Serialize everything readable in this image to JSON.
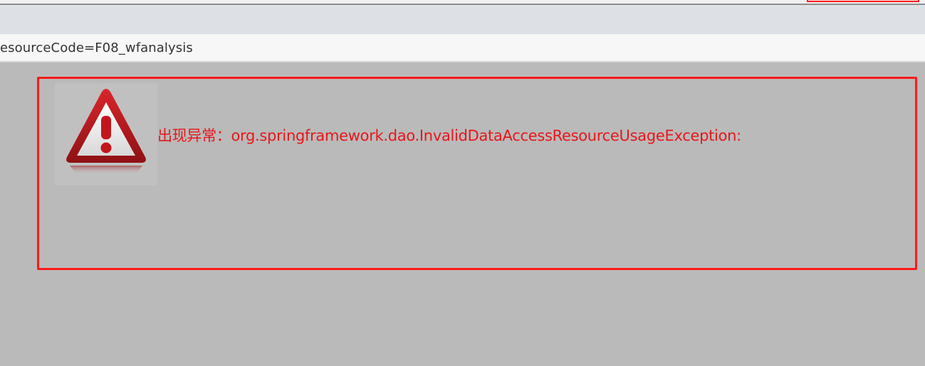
{
  "address_bar": {
    "url_fragment": "esourceCode=F08_wfanalysis"
  },
  "error": {
    "prefix": "出现异常：",
    "message": "org.springframework.dao.InvalidDataAccessResourceUsageException:",
    "icon": "warning-triangle-icon"
  },
  "colors": {
    "error_red": "#e8161a",
    "highlight_border": "#ff1a1a",
    "page_background": "#bababa"
  }
}
